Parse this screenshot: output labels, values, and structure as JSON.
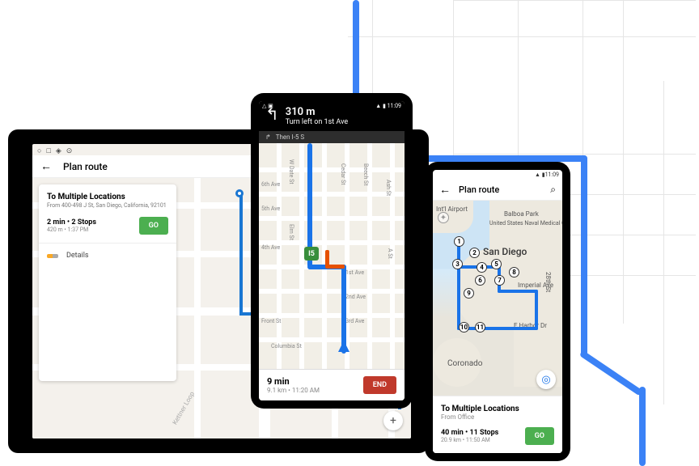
{
  "bg_route_color": "#3b82f6",
  "tablet": {
    "status_icons": [
      "○",
      "□",
      "◈",
      "⊙"
    ],
    "title": "Plan route",
    "panel": {
      "title": "To Multiple Locations",
      "subtitle": "From 400-498 J St, San Diego, California, 92101",
      "stats_main": "2 min • 2 Stops",
      "stats_sub": "420 m • 1:37 PM",
      "go_label": "GO",
      "details_label": "Details"
    }
  },
  "phone_nav": {
    "status_time": "11:09",
    "turn_distance": "310 m",
    "turn_instruction": "Turn left on 1st Ave",
    "next_label": "Then I-5 S",
    "streets": {
      "a": "Cedar St",
      "b": "Beech St",
      "c": "Ash St",
      "d": "A St",
      "e": "1st Ave",
      "f": "2nd Ave",
      "g": "3rd Ave",
      "h": "Elm St",
      "i": "4th Ave",
      "j": "5th Ave",
      "k": "6th Ave",
      "l": "Front St",
      "m": "W Date St",
      "col": "Columbia St"
    },
    "shield_label": "I5",
    "eta_time": "9 min",
    "eta_sub": "9.1 km • 11:20 AM",
    "end_label": "END"
  },
  "phone_plan": {
    "status_time": "11:09",
    "title": "Plan route",
    "map_labels": {
      "city": "San Diego",
      "coronado": "Coronado",
      "balboa": "Balboa Park",
      "navy": "United States Naval Medical C",
      "airport": "Int'l Airport",
      "harbor": "E Harbor Dr",
      "imperial": "Imperial Ave",
      "th28": "28th St"
    },
    "stops": [
      "1",
      "2",
      "3",
      "4",
      "5",
      "6",
      "7",
      "8",
      "9",
      "10",
      "11"
    ],
    "panel": {
      "title": "To Multiple Locations",
      "subtitle": "From Office",
      "stats_main": "40 min • 11 Stops",
      "stats_sub": "20.9 km • 11:50 AM",
      "go_label": "GO"
    }
  }
}
